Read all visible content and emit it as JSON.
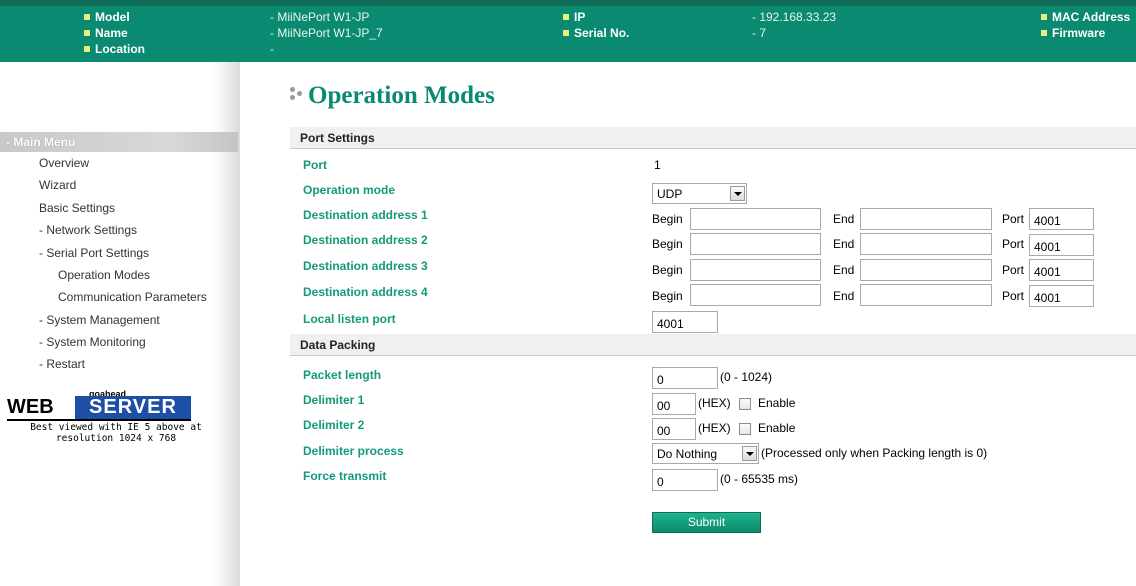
{
  "header": {
    "fields": [
      {
        "label": "Model",
        "value": "- MiiNePort W1-JP"
      },
      {
        "label": "Name",
        "value": "- MiiNePort W1-JP_7"
      },
      {
        "label": "Location",
        "value": "-"
      },
      {
        "label": "IP",
        "value": "- 192.168.33.23"
      },
      {
        "label": "Serial No.",
        "value": "- 7"
      },
      {
        "label": "MAC Address",
        "value": ""
      },
      {
        "label": "Firmware",
        "value": ""
      }
    ]
  },
  "sidebar": {
    "menu_header": "- Main Menu",
    "items": [
      "Overview",
      "Wizard",
      "Basic Settings",
      "- Network Settings",
      "- Serial Port Settings",
      "Operation Modes",
      "Communication Parameters",
      "- System Management",
      "- System Monitoring",
      "- Restart"
    ],
    "logo": {
      "top": "goahead",
      "web": "WEB",
      "server": "SERVER"
    },
    "caption_line1": "Best viewed with IE 5 above at",
    "caption_line2": "resolution 1024 x 768"
  },
  "main": {
    "title": "Operation Modes",
    "port_settings": {
      "section_title": "Port Settings",
      "port_label": "Port",
      "port_value": "1",
      "operation_mode_label": "Operation mode",
      "operation_mode_value": "UDP",
      "begin_label": "Begin",
      "end_label": "End",
      "port_field_label": "Port",
      "destinations": [
        {
          "label": "Destination address 1",
          "begin": "",
          "end": "",
          "port": "4001"
        },
        {
          "label": "Destination address 2",
          "begin": "",
          "end": "",
          "port": "4001"
        },
        {
          "label": "Destination address 3",
          "begin": "",
          "end": "",
          "port": "4001"
        },
        {
          "label": "Destination address 4",
          "begin": "",
          "end": "",
          "port": "4001"
        }
      ],
      "local_listen_port_label": "Local listen port",
      "local_listen_port_value": "4001"
    },
    "data_packing": {
      "section_title": "Data Packing",
      "packet_length_label": "Packet length",
      "packet_length_value": "0",
      "packet_length_hint": "(0 - 1024)",
      "delimiter1_label": "Delimiter 1",
      "delimiter1_value": "00",
      "delimiter2_label": "Delimiter 2",
      "delimiter2_value": "00",
      "hex_hint": "(HEX)",
      "enable_label": "Enable",
      "delimiter_process_label": "Delimiter process",
      "delimiter_process_value": "Do Nothing",
      "delimiter_process_hint": "(Processed only when Packing length is 0)",
      "force_transmit_label": "Force transmit",
      "force_transmit_value": "0",
      "force_transmit_hint": "(0 - 65535 ms)"
    },
    "submit_label": "Submit"
  }
}
